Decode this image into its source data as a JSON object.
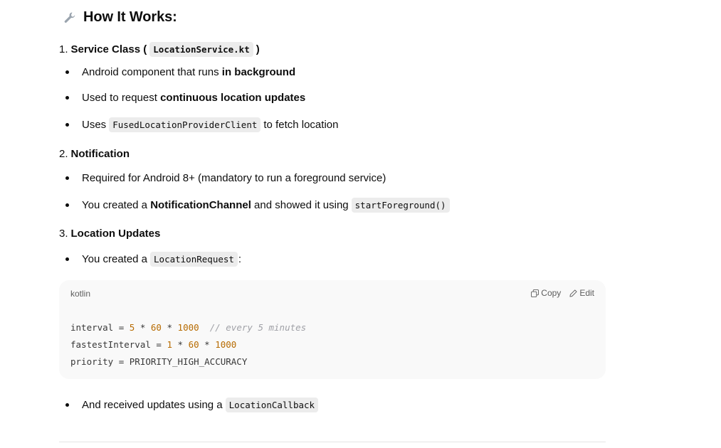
{
  "heading": {
    "icon": "wrench-icon",
    "text": "How It Works:"
  },
  "sections": [
    {
      "number": "1.",
      "title": "Service Class (",
      "code": "LocationService.kt",
      "title_end": ")",
      "bullets": [
        {
          "pre": "Android component that runs ",
          "bold": "in background"
        },
        {
          "pre": "Used to request ",
          "bold": "continuous location updates"
        },
        {
          "pre": "Uses",
          "code": "FusedLocationProviderClient",
          "post": "to fetch location"
        }
      ]
    },
    {
      "number": "2.",
      "title": "Notification",
      "bullets": [
        {
          "pre": "Required for Android 8+ (mandatory to run a foreground service)"
        },
        {
          "pre": "You created a ",
          "bold": "NotificationChannel",
          "post": " and showed it using",
          "code": "startForeground()"
        }
      ]
    },
    {
      "number": "3.",
      "title": "Location Updates",
      "bullets": [
        {
          "pre": "You created a",
          "code": "LocationRequest",
          "post": ":"
        }
      ]
    }
  ],
  "code_block": {
    "language": "kotlin",
    "copy_label": "Copy",
    "edit_label": "Edit",
    "lines": [
      {
        "a": "interval = ",
        "n1": "5",
        "op1": " * ",
        "n2": "60",
        "op2": " * ",
        "n3": "1000",
        "comment": "  // every 5 minutes"
      },
      {
        "a": "fastestInterval = ",
        "n1": "1",
        "op1": " * ",
        "n2": "60",
        "op2": " * ",
        "n3": "1000"
      },
      {
        "a": "priority = PRIORITY_HIGH_ACCURACY"
      }
    ]
  },
  "final_bullet": {
    "pre": "And received updates using a",
    "code": "LocationCallback"
  }
}
